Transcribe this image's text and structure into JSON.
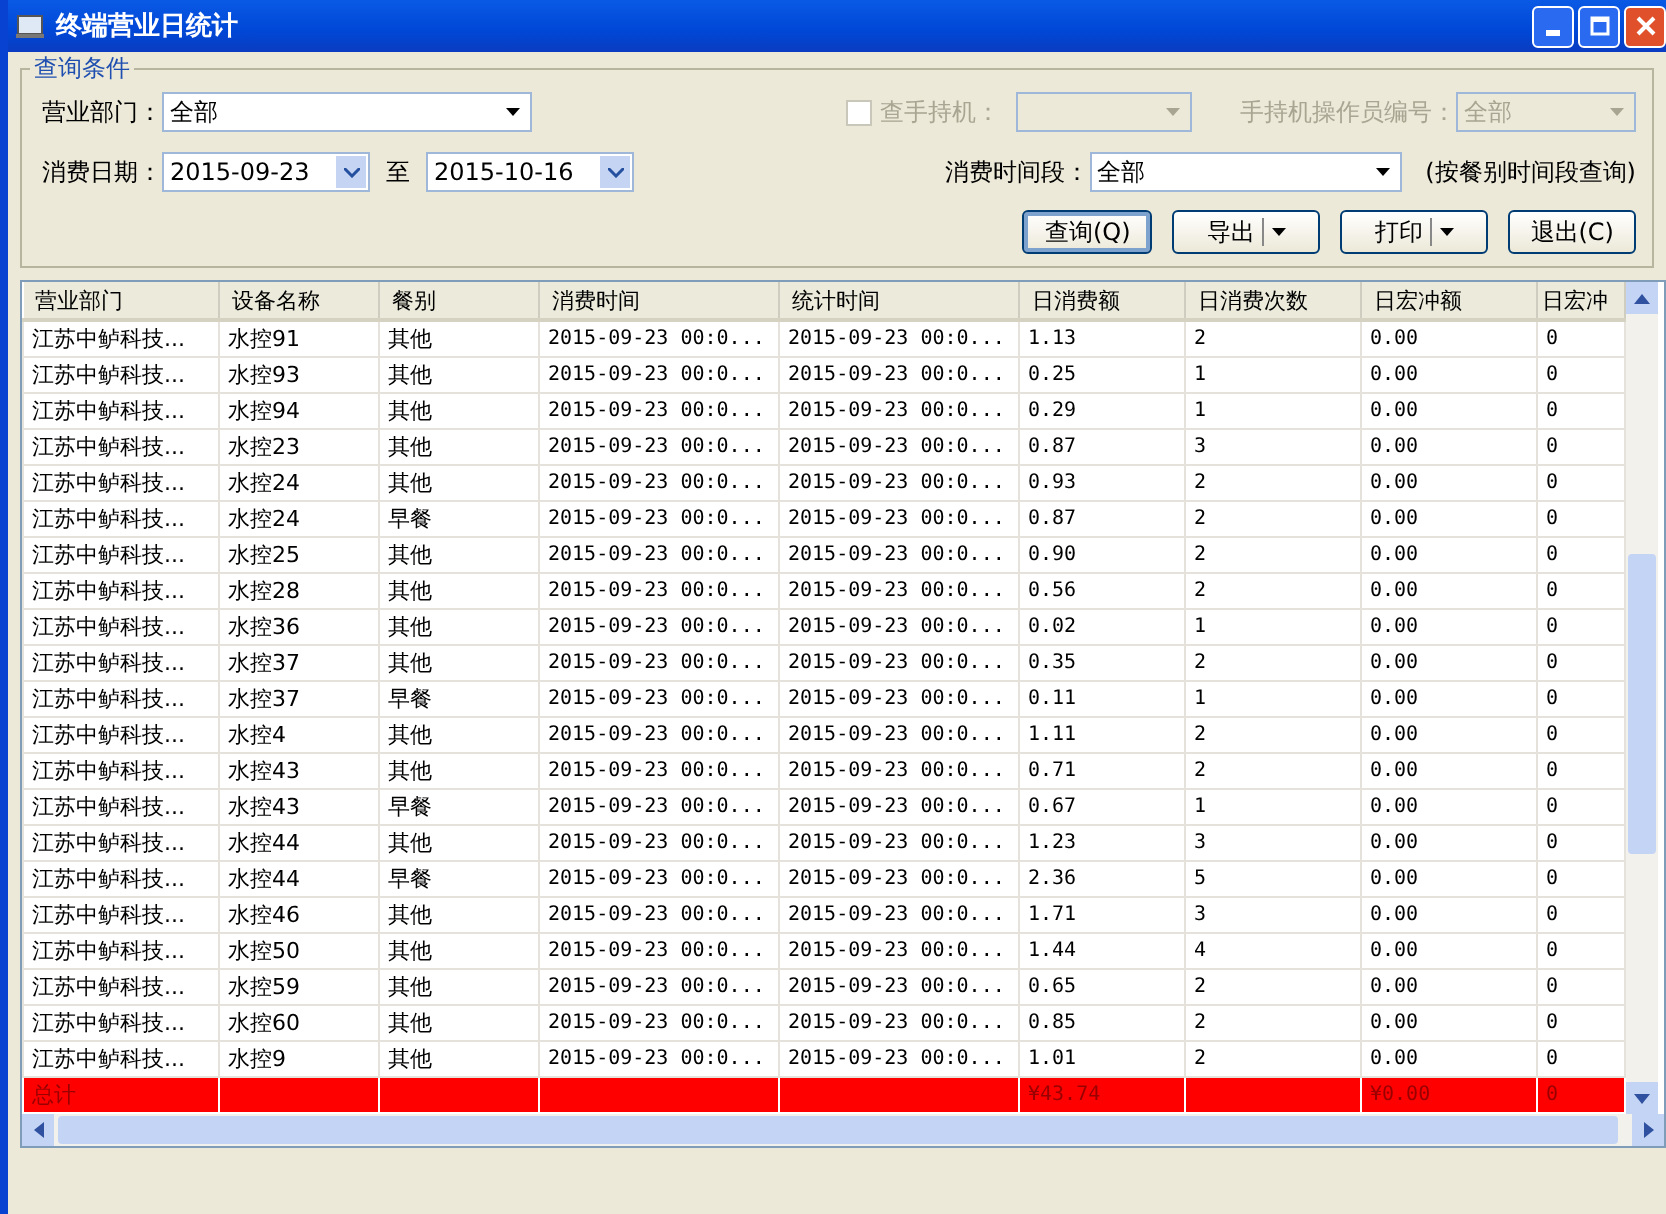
{
  "window": {
    "title": "终端营业日统计"
  },
  "query": {
    "legend": "查询条件",
    "department": {
      "label": "营业部门：",
      "value": "全部"
    },
    "handheld": {
      "label": "查手持机：",
      "checked": false,
      "disabled": true
    },
    "operator": {
      "label": "手持机操作员编号：",
      "value": "全部",
      "disabled": true
    },
    "date": {
      "label": "消费日期：",
      "from": "2015-09-23",
      "sep": "至",
      "to": "2015-10-16"
    },
    "period": {
      "label": "消费时间段：",
      "value": "全部",
      "hint": "(按餐别时间段查询)"
    },
    "buttons": [
      {
        "label": "查询(Q)",
        "kind": "plain",
        "focused": true
      },
      {
        "label": "导出",
        "kind": "split",
        "focused": false
      },
      {
        "label": "打印",
        "kind": "split",
        "focused": false
      },
      {
        "label": "退出(C)",
        "kind": "plain",
        "focused": false
      }
    ]
  },
  "table": {
    "columns": [
      "营业部门",
      "设备名称",
      "餐别",
      "消费时间",
      "统计时间",
      "日消费额",
      "日消费次数",
      "日宏冲额",
      "日宏冲"
    ],
    "rows": [
      [
        "江苏中鲈科技...",
        "水控91",
        "其他",
        "2015-09-23 00:0...",
        "2015-09-23 00:0...",
        "1.13",
        "2",
        "0.00",
        "0"
      ],
      [
        "江苏中鲈科技...",
        "水控93",
        "其他",
        "2015-09-23 00:0...",
        "2015-09-23 00:0...",
        "0.25",
        "1",
        "0.00",
        "0"
      ],
      [
        "江苏中鲈科技...",
        "水控94",
        "其他",
        "2015-09-23 00:0...",
        "2015-09-23 00:0...",
        "0.29",
        "1",
        "0.00",
        "0"
      ],
      [
        "江苏中鲈科技...",
        "水控23",
        "其他",
        "2015-09-23 00:0...",
        "2015-09-23 00:0...",
        "0.87",
        "3",
        "0.00",
        "0"
      ],
      [
        "江苏中鲈科技...",
        "水控24",
        "其他",
        "2015-09-23 00:0...",
        "2015-09-23 00:0...",
        "0.93",
        "2",
        "0.00",
        "0"
      ],
      [
        "江苏中鲈科技...",
        "水控24",
        "早餐",
        "2015-09-23 00:0...",
        "2015-09-23 00:0...",
        "0.87",
        "2",
        "0.00",
        "0"
      ],
      [
        "江苏中鲈科技...",
        "水控25",
        "其他",
        "2015-09-23 00:0...",
        "2015-09-23 00:0...",
        "0.90",
        "2",
        "0.00",
        "0"
      ],
      [
        "江苏中鲈科技...",
        "水控28",
        "其他",
        "2015-09-23 00:0...",
        "2015-09-23 00:0...",
        "0.56",
        "2",
        "0.00",
        "0"
      ],
      [
        "江苏中鲈科技...",
        "水控36",
        "其他",
        "2015-09-23 00:0...",
        "2015-09-23 00:0...",
        "0.02",
        "1",
        "0.00",
        "0"
      ],
      [
        "江苏中鲈科技...",
        "水控37",
        "其他",
        "2015-09-23 00:0...",
        "2015-09-23 00:0...",
        "0.35",
        "2",
        "0.00",
        "0"
      ],
      [
        "江苏中鲈科技...",
        "水控37",
        "早餐",
        "2015-09-23 00:0...",
        "2015-09-23 00:0...",
        "0.11",
        "1",
        "0.00",
        "0"
      ],
      [
        "江苏中鲈科技...",
        "水控4",
        "其他",
        "2015-09-23 00:0...",
        "2015-09-23 00:0...",
        "1.11",
        "2",
        "0.00",
        "0"
      ],
      [
        "江苏中鲈科技...",
        "水控43",
        "其他",
        "2015-09-23 00:0...",
        "2015-09-23 00:0...",
        "0.71",
        "2",
        "0.00",
        "0"
      ],
      [
        "江苏中鲈科技...",
        "水控43",
        "早餐",
        "2015-09-23 00:0...",
        "2015-09-23 00:0...",
        "0.67",
        "1",
        "0.00",
        "0"
      ],
      [
        "江苏中鲈科技...",
        "水控44",
        "其他",
        "2015-09-23 00:0...",
        "2015-09-23 00:0...",
        "1.23",
        "3",
        "0.00",
        "0"
      ],
      [
        "江苏中鲈科技...",
        "水控44",
        "早餐",
        "2015-09-23 00:0...",
        "2015-09-23 00:0...",
        "2.36",
        "5",
        "0.00",
        "0"
      ],
      [
        "江苏中鲈科技...",
        "水控46",
        "其他",
        "2015-09-23 00:0...",
        "2015-09-23 00:0...",
        "1.71",
        "3",
        "0.00",
        "0"
      ],
      [
        "江苏中鲈科技...",
        "水控50",
        "其他",
        "2015-09-23 00:0...",
        "2015-09-23 00:0...",
        "1.44",
        "4",
        "0.00",
        "0"
      ],
      [
        "江苏中鲈科技...",
        "水控59",
        "其他",
        "2015-09-23 00:0...",
        "2015-09-23 00:0...",
        "0.65",
        "2",
        "0.00",
        "0"
      ],
      [
        "江苏中鲈科技...",
        "水控60",
        "其他",
        "2015-09-23 00:0...",
        "2015-09-23 00:0...",
        "0.85",
        "2",
        "0.00",
        "0"
      ],
      [
        "江苏中鲈科技...",
        "水控9",
        "其他",
        "2015-09-23 00:0...",
        "2015-09-23 00:0...",
        "1.01",
        "2",
        "0.00",
        "0"
      ]
    ],
    "total": {
      "label": "总计",
      "amount": "¥43.74",
      "macro_amount": "¥0.00",
      "macro_count": "0"
    }
  }
}
